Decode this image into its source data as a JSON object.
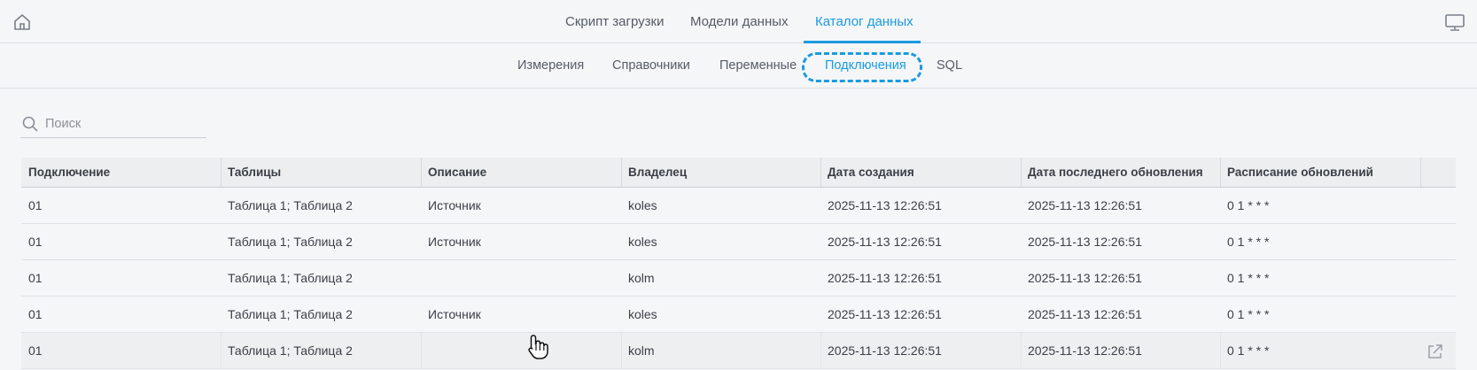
{
  "top_nav": {
    "tabs": [
      {
        "label": "Скрипт загрузки",
        "active": false
      },
      {
        "label": "Модели данных",
        "active": false
      },
      {
        "label": "Каталог данных",
        "active": true
      }
    ],
    "home_icon": "home-icon",
    "monitor_icon": "monitor-icon"
  },
  "sub_nav": {
    "tabs": [
      {
        "label": "Измерения",
        "active": false
      },
      {
        "label": "Справочники",
        "active": false
      },
      {
        "label": "Переменные",
        "active": false
      },
      {
        "label": "Подключения",
        "active": true
      },
      {
        "label": "SQL",
        "active": false
      }
    ]
  },
  "search": {
    "placeholder": "Поиск",
    "value": "",
    "icon": "search-icon"
  },
  "table": {
    "columns": [
      "Подключение",
      "Таблицы",
      "Описание",
      "Владелец",
      "Дата создания",
      "Дата последнего обновления",
      "Расписание обновлений"
    ],
    "rows": [
      [
        "01",
        "Таблица 1; Таблица 2",
        "Источник",
        "koles",
        "2025-11-13 12:26:51",
        "2025-11-13 12:26:51",
        "0 1 * * *"
      ],
      [
        "01",
        "Таблица 1; Таблица 2",
        "Источник",
        "koles",
        "2025-11-13 12:26:51",
        "2025-11-13 12:26:51",
        "0 1 * * *"
      ],
      [
        "01",
        "Таблица 1; Таблица 2",
        "",
        "kolm",
        "2025-11-13 12:26:51",
        "2025-11-13 12:26:51",
        "0 1 * * *"
      ],
      [
        "01",
        "Таблица 1; Таблица 2",
        "Источник",
        "koles",
        "2025-11-13 12:26:51",
        "2025-11-13 12:26:51",
        "0 1 * * *"
      ],
      [
        "01",
        "Таблица 1; Таблица 2",
        "",
        "kolm",
        "2025-11-13 12:26:51",
        "2025-11-13 12:26:51",
        "0 1 * * *"
      ]
    ],
    "hovered_row": 4,
    "row_action_icon": "external-link-icon"
  },
  "colors": {
    "accent": "#1a9be0",
    "text": "#3a3f46",
    "background": "#f5f6f8"
  }
}
